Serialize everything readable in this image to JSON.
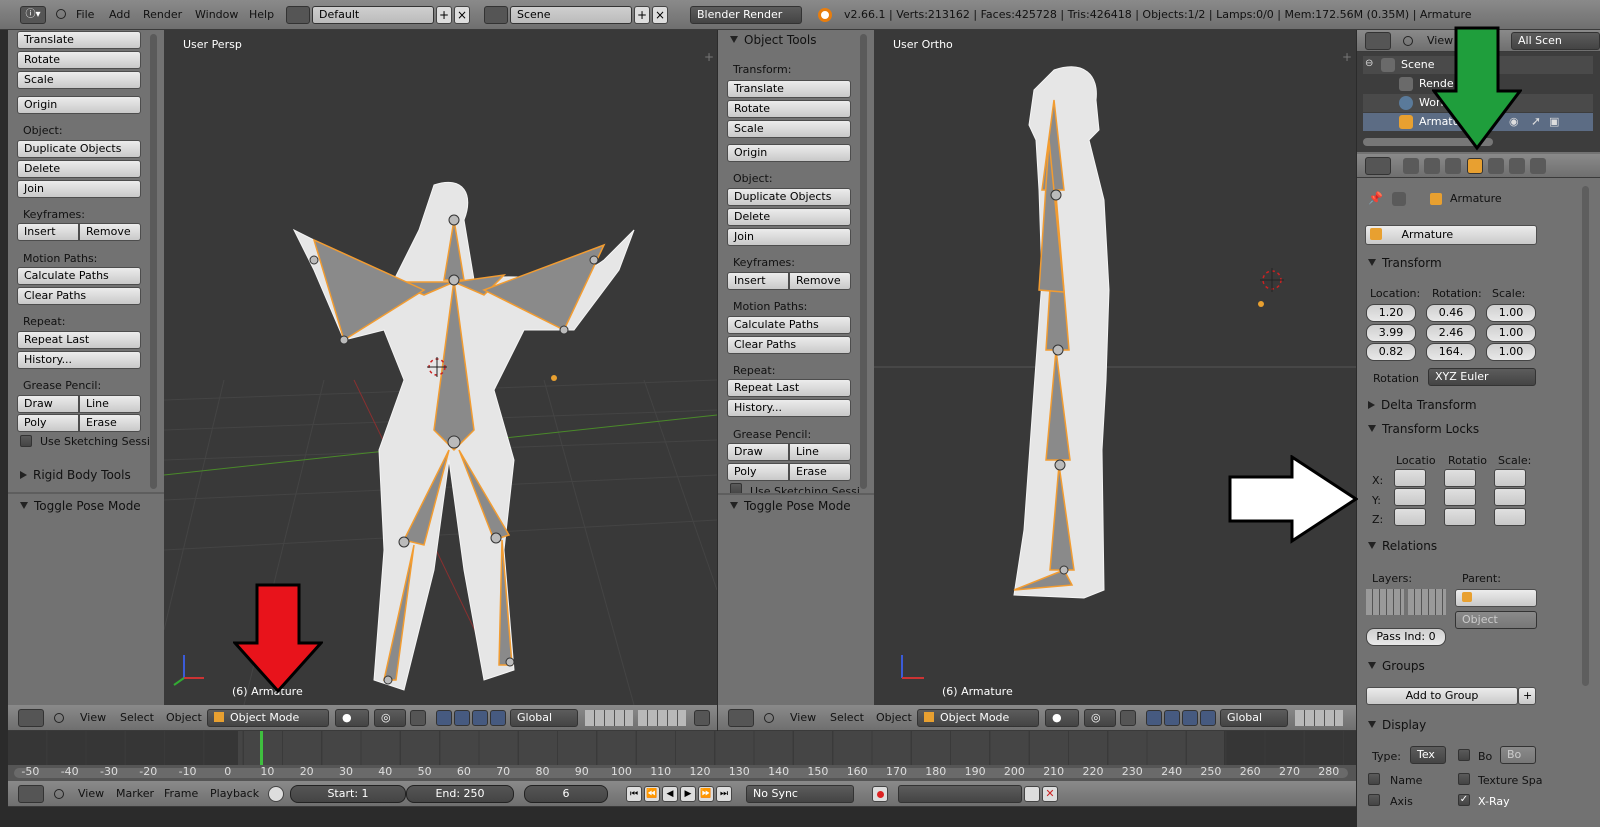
{
  "top_header": {
    "menus": [
      "File",
      "Add",
      "Render",
      "Window",
      "Help"
    ],
    "layout": "Default",
    "scene": "Scene",
    "engine": "Blender Render",
    "stats": "v2.66.1 | Verts:213162 | Faces:425728 | Tris:426418 | Objects:1/2 | Lamps:0/0 | Mem:172.56M (0.35M) | Armature"
  },
  "tool_shelf": {
    "panel_title": "Object Tools",
    "transform_label": "Transform:",
    "translate": "Translate",
    "rotate": "Rotate",
    "scale": "Scale",
    "origin": "Origin",
    "object_label": "Object:",
    "duplicate": "Duplicate Objects",
    "delete": "Delete",
    "join": "Join",
    "keyframes_label": "Keyframes:",
    "insert": "Insert",
    "remove": "Remove",
    "motion_label": "Motion Paths:",
    "calc_paths": "Calculate Paths",
    "clear_paths": "Clear Paths",
    "repeat_label": "Repeat:",
    "repeat_last": "Repeat Last",
    "history": "History...",
    "grease_label": "Grease Pencil:",
    "draw": "Draw",
    "line": "Line",
    "poly": "Poly",
    "erase": "Erase",
    "sketching": "Use Sketching Sessi",
    "rigid_body": "Rigid Body Tools",
    "toggle_pose": "Toggle Pose Mode"
  },
  "viewport_left": {
    "label": "User Persp",
    "object_label": "(6) Armature"
  },
  "viewport_right": {
    "label": "User Ortho",
    "object_label": "(6) Armature"
  },
  "view_header": {
    "menus": [
      "View",
      "Select",
      "Object"
    ],
    "mode": "Object Mode",
    "orientation": "Global"
  },
  "outliner": {
    "view_menu": "View",
    "search_filter": "All Scen",
    "items": [
      "Scene",
      "Render",
      "Worl",
      "Armatu"
    ]
  },
  "properties": {
    "breadcrumb": "Armature",
    "object_name": "Armature",
    "transform_title": "Transform",
    "location_label": "Location:",
    "rotation_label": "Rotation:",
    "scale_label": "Scale:",
    "location": [
      "1.20",
      "3.99",
      "0.82"
    ],
    "rotation": [
      "0.46",
      "2.46",
      "164."
    ],
    "scale": [
      "1.00",
      "1.00",
      "1.00"
    ],
    "rotation_mode_label": "Rotation",
    "rotation_mode": "XYZ Euler",
    "delta_title": "Delta Transform",
    "locks_title": "Transform Locks",
    "locks_headers": [
      "Locatio",
      "Rotatio",
      "Scale:"
    ],
    "axes": [
      "X:",
      "Y:",
      "Z:"
    ],
    "relations_title": "Relations",
    "layers_label": "Layers:",
    "parent_label": "Parent:",
    "parent_type": "Object",
    "pass_index": "Pass Ind: 0",
    "groups_title": "Groups",
    "add_group": "Add to Group",
    "display_title": "Display",
    "type_label": "Type:",
    "type_value": "Tex",
    "bounds": "Bo",
    "bounds_value": "Bo",
    "name_check": "Name",
    "texture_space": "Texture Spa",
    "axis_check": "Axis",
    "xray_check": "X-Ray"
  },
  "timeline": {
    "ticks": [
      "-50",
      "-40",
      "-30",
      "-20",
      "-10",
      "0",
      "10",
      "20",
      "30",
      "40",
      "50",
      "60",
      "70",
      "80",
      "90",
      "100",
      "110",
      "120",
      "130",
      "140",
      "150",
      "160",
      "170",
      "180",
      "190",
      "200",
      "210",
      "220",
      "230",
      "240",
      "250",
      "260",
      "270",
      "280"
    ],
    "menus": [
      "View",
      "Marker",
      "Frame",
      "Playback"
    ],
    "start": "Start: 1",
    "end": "End: 250",
    "current": "6",
    "sync": "No Sync"
  },
  "colors": {
    "red_arrow": "#e8131b",
    "green_arrow": "#1f9e3c",
    "white_arrow": "#ffffff",
    "selection_outline": "#f29c31",
    "frame_marker": "#3fbf3f"
  }
}
